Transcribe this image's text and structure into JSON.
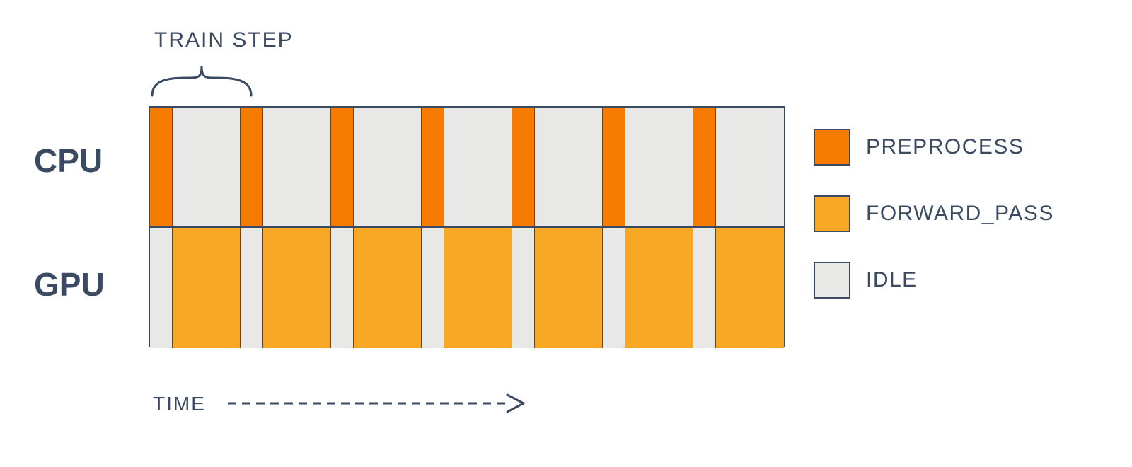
{
  "train_step_label": "TRAIN STEP",
  "row_labels": {
    "cpu": "CPU",
    "gpu": "GPU"
  },
  "time_label": "TIME",
  "legend": {
    "preprocess": "PREPROCESS",
    "forward_pass": "FORWARD_PASS",
    "idle": "IDLE"
  },
  "colors": {
    "preprocess": "#f57c00",
    "forward_pass": "#f9a825",
    "idle": "#e8e8e6",
    "border": "#3b4a63",
    "text": "#3b4a63"
  },
  "chart_data": {
    "type": "area",
    "title": "CPU/GPU timeline for sequential train steps",
    "xlabel": "TIME",
    "ylabel": "",
    "rows": [
      "CPU",
      "GPU"
    ],
    "segments": {
      "CPU": [
        {
          "state": "preprocess",
          "units": 1
        },
        {
          "state": "idle",
          "units": 3
        },
        {
          "state": "preprocess",
          "units": 1
        },
        {
          "state": "idle",
          "units": 3
        },
        {
          "state": "preprocess",
          "units": 1
        },
        {
          "state": "idle",
          "units": 3
        },
        {
          "state": "preprocess",
          "units": 1
        },
        {
          "state": "idle",
          "units": 3
        },
        {
          "state": "preprocess",
          "units": 1
        },
        {
          "state": "idle",
          "units": 3
        },
        {
          "state": "preprocess",
          "units": 1
        },
        {
          "state": "idle",
          "units": 3
        },
        {
          "state": "preprocess",
          "units": 1
        },
        {
          "state": "idle",
          "units": 3
        }
      ],
      "GPU": [
        {
          "state": "idle",
          "units": 1
        },
        {
          "state": "forward_pass",
          "units": 3
        },
        {
          "state": "idle",
          "units": 1
        },
        {
          "state": "forward_pass",
          "units": 3
        },
        {
          "state": "idle",
          "units": 1
        },
        {
          "state": "forward_pass",
          "units": 3
        },
        {
          "state": "idle",
          "units": 1
        },
        {
          "state": "forward_pass",
          "units": 3
        },
        {
          "state": "idle",
          "units": 1
        },
        {
          "state": "forward_pass",
          "units": 3
        },
        {
          "state": "idle",
          "units": 1
        },
        {
          "state": "forward_pass",
          "units": 3
        },
        {
          "state": "idle",
          "units": 1
        },
        {
          "state": "forward_pass",
          "units": 3
        }
      ]
    },
    "total_units": 28,
    "train_step_span_units": 4
  }
}
